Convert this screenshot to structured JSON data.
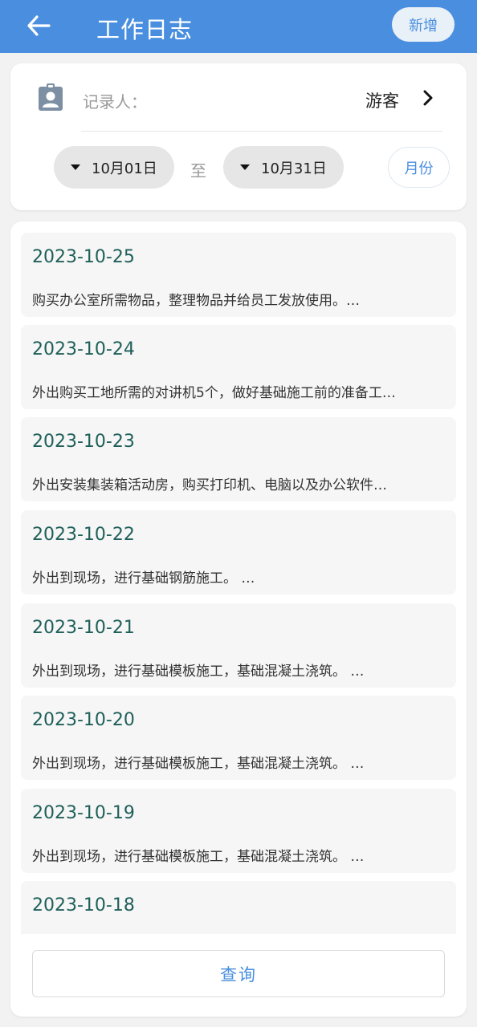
{
  "header": {
    "title": "工作日志",
    "add_label": "新增",
    "back_icon": "arrow-left-icon"
  },
  "filter": {
    "recorder_label": "记录人：",
    "recorder_value": "游客",
    "start_date": "10月01日",
    "to_label": "至",
    "end_date": "10月31日",
    "month_label": "月份"
  },
  "logs": [
    {
      "date": "2023-10-25",
      "desc": "购买办公室所需物品，整理物品并给员工发放使用。…"
    },
    {
      "date": "2023-10-24",
      "desc": "外出购买工地所需的对讲机5个，做好基础施工前的准备工…"
    },
    {
      "date": "2023-10-23",
      "desc": "外出安装集装箱活动房，购买打印机、电脑以及办公软件…"
    },
    {
      "date": "2023-10-22",
      "desc": "外出到现场，进行基础钢筋施工。 …"
    },
    {
      "date": "2023-10-21",
      "desc": "外出到现场，进行基础模板施工，基础混凝土浇筑。 …"
    },
    {
      "date": "2023-10-20",
      "desc": "外出到现场，进行基础模板施工，基础混凝土浇筑。 …"
    },
    {
      "date": "2023-10-19",
      "desc": "外出到现场，进行基础模板施工，基础混凝土浇筑。 …"
    },
    {
      "date": "2023-10-18",
      "desc": ""
    }
  ],
  "query_label": "查询",
  "colors": {
    "header_bg": "#4a8fdf",
    "accent": "#4a8fdf",
    "date_text": "#1f5f5a"
  }
}
